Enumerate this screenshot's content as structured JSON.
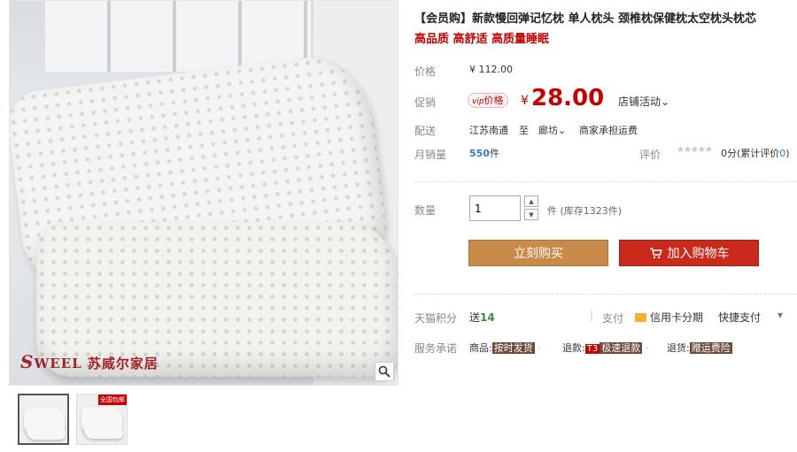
{
  "gallery": {
    "brand_logo": "SWEEL 苏威尔家居",
    "brand_logo_initial": "S",
    "brand_logo_rest": "WEEL 苏威尔家居",
    "thumbnails": [
      {
        "badge": ""
      },
      {
        "badge": "全国包邮"
      }
    ]
  },
  "product": {
    "title": "【会员购】新款慢回弹记忆枕 单人枕头 颈椎枕保健枕太空枕头枕芯",
    "subtitle": "高品质 高舒适 高质量睡眠"
  },
  "price": {
    "label": "价格",
    "original": "¥ 112.00"
  },
  "promo": {
    "label": "促销",
    "vip_prefix": "vip",
    "vip_suffix": "价格",
    "currency": "¥",
    "price": "28.00",
    "store_event": "店铺活动",
    "store_event_caret": "⌄"
  },
  "shipping": {
    "label": "配送",
    "from": "江苏南通",
    "to_word": "至",
    "to": "廊坊",
    "to_caret": "⌄",
    "fee": "商家承担运费"
  },
  "sales": {
    "label": "月销量",
    "count": "550",
    "unit": "件",
    "rating_label": "评价",
    "stars": "★★★★★",
    "score_text": "0分(累计评价",
    "review_count": "0",
    "close_paren": ")"
  },
  "quantity": {
    "label": "数量",
    "value": "1",
    "up": "▲",
    "down": "▼",
    "stock_text": "件 (库存1323件)"
  },
  "actions": {
    "buy_now": "立刻购买",
    "add_to_cart": "加入购物车"
  },
  "points": {
    "label": "天猫积分",
    "give_word": "送",
    "amount": "14"
  },
  "payment": {
    "label": "支付",
    "credit_card": "信用卡分期",
    "quick_pay": "快捷支付",
    "caret": "▾"
  },
  "service": {
    "label": "服务承诺",
    "items": [
      {
        "prefix": "商品:",
        "tag": "按时发货",
        "sep": "·"
      },
      {
        "prefix": "退款:",
        "tag_small": "T3",
        "tag": "极速退款",
        "sep": "·"
      },
      {
        "prefix": "退货:",
        "tag": "赠运费险"
      }
    ]
  },
  "colors": {
    "accent_red": "#c40000",
    "buy_button": "#c98b49",
    "cart_button": "#c92a1c",
    "sales_blue": "#2a7fbf",
    "points_green": "#3a8a3a"
  },
  "icons": [
    "zoom-icon",
    "cart-icon",
    "credit-card-icon",
    "chevron-down-icon",
    "star-icon"
  ]
}
